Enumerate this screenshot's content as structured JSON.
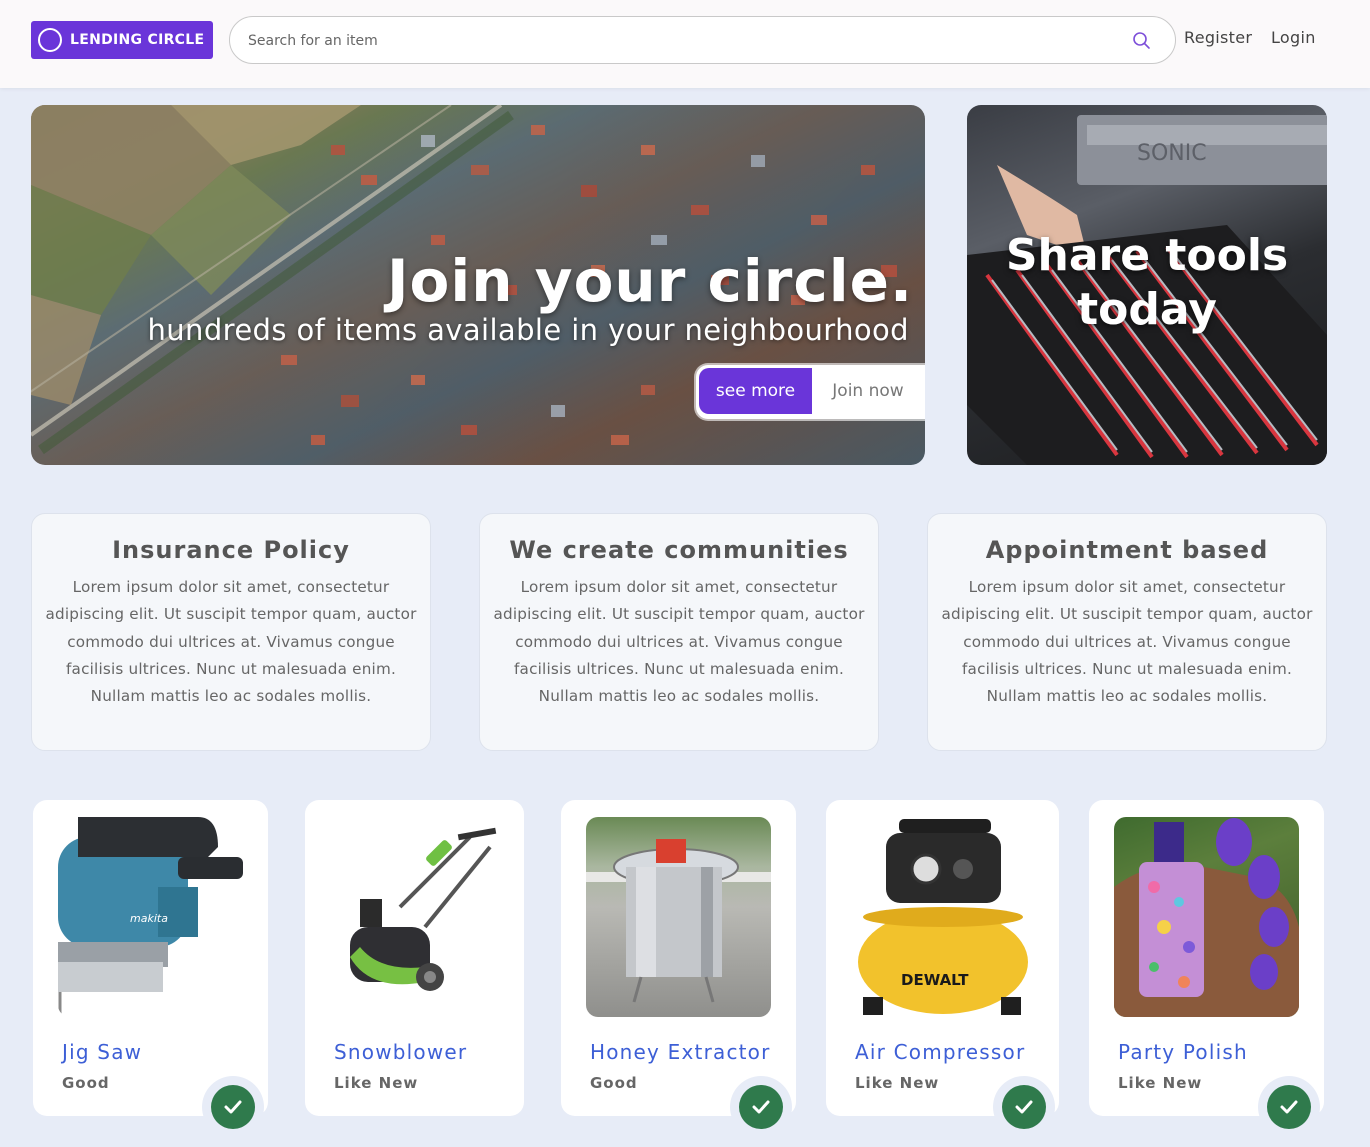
{
  "header": {
    "logo_text": "LENDING CIRCLE",
    "search_placeholder": "Search for an item",
    "register": "Register",
    "login": "Login"
  },
  "hero": {
    "title": "Join your circle.",
    "subtitle": "hundreds of items available in your neighbourhood",
    "see_more": "see more",
    "join_now": "Join now"
  },
  "promo": {
    "line1": "Share tools",
    "line2": "today"
  },
  "info_cards": [
    {
      "title": "Insurance Policy",
      "text": "Lorem ipsum dolor sit amet, consectetur adipiscing elit. Ut suscipit tempor quam, auctor commodo dui ultrices at. Vivamus congue facilisis ultrices. Nunc ut malesuada enim. Nullam mattis leo ac sodales mollis."
    },
    {
      "title": "We create communities",
      "text": "Lorem ipsum dolor sit amet, consectetur adipiscing elit. Ut suscipit tempor quam, auctor commodo dui ultrices at. Vivamus congue facilisis ultrices. Nunc ut malesuada enim. Nullam mattis leo ac sodales mollis."
    },
    {
      "title": "Appointment based",
      "text": "Lorem ipsum dolor sit amet, consectetur adipiscing elit. Ut suscipit tempor quam, auctor commodo dui ultrices at. Vivamus congue facilisis ultrices. Nunc ut malesuada enim. Nullam mattis leo ac sodales mollis."
    }
  ],
  "items": [
    {
      "name": "Jig Saw",
      "condition": "Good",
      "available": true,
      "icon": "jig-saw-image"
    },
    {
      "name": "Snowblower",
      "condition": "Like New",
      "available": false,
      "icon": "snowblower-image"
    },
    {
      "name": "Honey Extractor",
      "condition": "Good",
      "available": true,
      "icon": "honey-extractor-image"
    },
    {
      "name": "Air Compressor",
      "condition": "Like New",
      "available": true,
      "icon": "air-compressor-image"
    },
    {
      "name": "Party Polish",
      "condition": "Like New",
      "available": true,
      "icon": "nail-polish-image"
    }
  ],
  "image_labels": {
    "jig_saw_brand": "makita",
    "compressor_brand": "DEWALT",
    "toolbox_brand": "SONIC"
  },
  "colors": {
    "accent": "#6a35d9",
    "link": "#3d5fd6",
    "check": "#2f7a4c",
    "background": "#e7ecf7"
  }
}
